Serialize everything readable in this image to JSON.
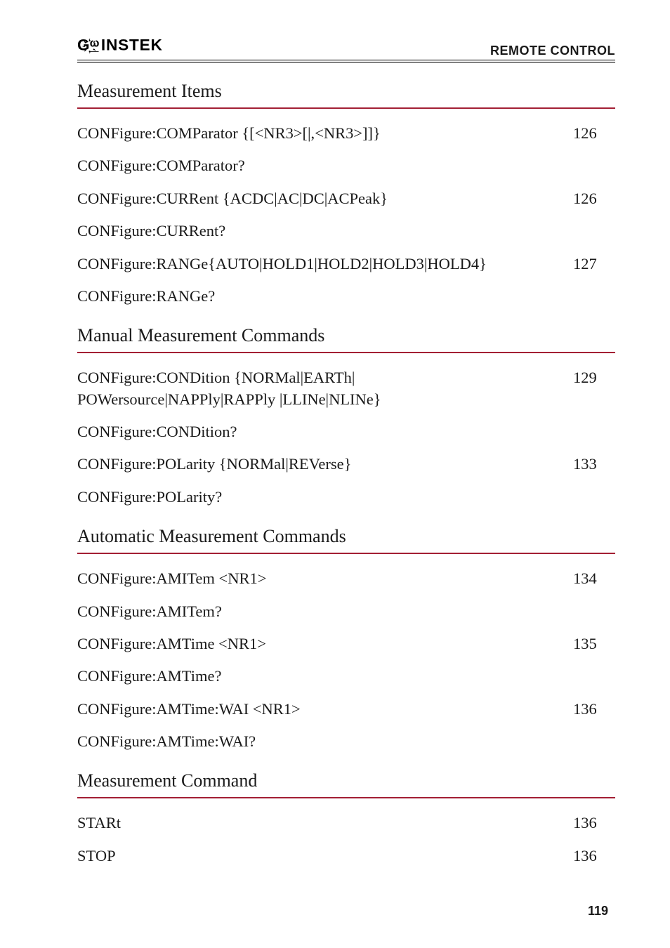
{
  "header": {
    "brand_text": "GWINSTEK",
    "doc_title": "REMOTE CONTROL"
  },
  "sections": [
    {
      "title": "Measurement Items",
      "entries": [
        {
          "label": "CONFigure:COMParator {[<NR3>[|,<NR3>]]}",
          "page": "126"
        },
        {
          "label": "CONFigure:COMParator?",
          "page": ""
        },
        {
          "label": "CONFigure:CURRent {ACDC|AC|DC|ACPeak}",
          "page": "126"
        },
        {
          "label": "CONFigure:CURRent?",
          "page": ""
        },
        {
          "label": "CONFigure:RANGe{AUTO|HOLD1|HOLD2|HOLD3|HOLD4}",
          "page": "127"
        },
        {
          "label": "CONFigure:RANGe?",
          "page": ""
        }
      ]
    },
    {
      "title": "Manual Measurement Commands",
      "entries": [
        {
          "label": "CONFigure:CONDition {NORMal|EARTh| POWersource|NAPPly|RAPPly |LLINe|NLINe}",
          "page": "129"
        },
        {
          "label": "CONFigure:CONDition?",
          "page": ""
        },
        {
          "label": "CONFigure:POLarity {NORMal|REVerse}",
          "page": "133"
        },
        {
          "label": "CONFigure:POLarity?",
          "page": ""
        }
      ]
    },
    {
      "title": "Automatic Measurement Commands",
      "entries": [
        {
          "label": "CONFigure:AMITem <NR1>",
          "page": "134"
        },
        {
          "label": "CONFigure:AMITem?",
          "page": ""
        },
        {
          "label": "CONFigure:AMTime <NR1>",
          "page": "135"
        },
        {
          "label": "CONFigure:AMTime?",
          "page": ""
        },
        {
          "label": "CONFigure:AMTime:WAI <NR1>",
          "page": "136"
        },
        {
          "label": "CONFigure:AMTime:WAI?",
          "page": ""
        }
      ]
    },
    {
      "title": "Measurement Command",
      "entries": [
        {
          "label": "STARt",
          "page": "136"
        },
        {
          "label": "STOP",
          "page": "136"
        }
      ]
    }
  ],
  "footer": {
    "page_number": "119"
  }
}
